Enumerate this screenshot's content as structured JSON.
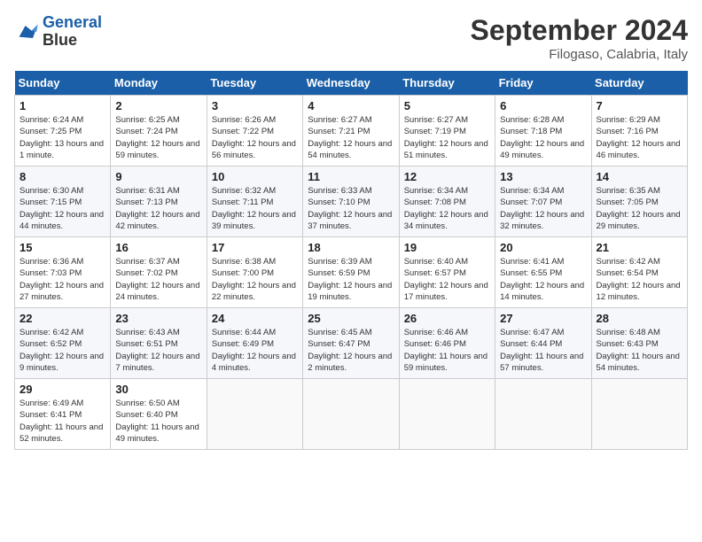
{
  "header": {
    "logo_general": "General",
    "logo_blue": "Blue",
    "month_title": "September 2024",
    "location": "Filogaso, Calabria, Italy"
  },
  "weekdays": [
    "Sunday",
    "Monday",
    "Tuesday",
    "Wednesday",
    "Thursday",
    "Friday",
    "Saturday"
  ],
  "weeks": [
    [
      {
        "day": "1",
        "sunrise": "Sunrise: 6:24 AM",
        "sunset": "Sunset: 7:25 PM",
        "daylight": "Daylight: 13 hours and 1 minute."
      },
      {
        "day": "2",
        "sunrise": "Sunrise: 6:25 AM",
        "sunset": "Sunset: 7:24 PM",
        "daylight": "Daylight: 12 hours and 59 minutes."
      },
      {
        "day": "3",
        "sunrise": "Sunrise: 6:26 AM",
        "sunset": "Sunset: 7:22 PM",
        "daylight": "Daylight: 12 hours and 56 minutes."
      },
      {
        "day": "4",
        "sunrise": "Sunrise: 6:27 AM",
        "sunset": "Sunset: 7:21 PM",
        "daylight": "Daylight: 12 hours and 54 minutes."
      },
      {
        "day": "5",
        "sunrise": "Sunrise: 6:27 AM",
        "sunset": "Sunset: 7:19 PM",
        "daylight": "Daylight: 12 hours and 51 minutes."
      },
      {
        "day": "6",
        "sunrise": "Sunrise: 6:28 AM",
        "sunset": "Sunset: 7:18 PM",
        "daylight": "Daylight: 12 hours and 49 minutes."
      },
      {
        "day": "7",
        "sunrise": "Sunrise: 6:29 AM",
        "sunset": "Sunset: 7:16 PM",
        "daylight": "Daylight: 12 hours and 46 minutes."
      }
    ],
    [
      {
        "day": "8",
        "sunrise": "Sunrise: 6:30 AM",
        "sunset": "Sunset: 7:15 PM",
        "daylight": "Daylight: 12 hours and 44 minutes."
      },
      {
        "day": "9",
        "sunrise": "Sunrise: 6:31 AM",
        "sunset": "Sunset: 7:13 PM",
        "daylight": "Daylight: 12 hours and 42 minutes."
      },
      {
        "day": "10",
        "sunrise": "Sunrise: 6:32 AM",
        "sunset": "Sunset: 7:11 PM",
        "daylight": "Daylight: 12 hours and 39 minutes."
      },
      {
        "day": "11",
        "sunrise": "Sunrise: 6:33 AM",
        "sunset": "Sunset: 7:10 PM",
        "daylight": "Daylight: 12 hours and 37 minutes."
      },
      {
        "day": "12",
        "sunrise": "Sunrise: 6:34 AM",
        "sunset": "Sunset: 7:08 PM",
        "daylight": "Daylight: 12 hours and 34 minutes."
      },
      {
        "day": "13",
        "sunrise": "Sunrise: 6:34 AM",
        "sunset": "Sunset: 7:07 PM",
        "daylight": "Daylight: 12 hours and 32 minutes."
      },
      {
        "day": "14",
        "sunrise": "Sunrise: 6:35 AM",
        "sunset": "Sunset: 7:05 PM",
        "daylight": "Daylight: 12 hours and 29 minutes."
      }
    ],
    [
      {
        "day": "15",
        "sunrise": "Sunrise: 6:36 AM",
        "sunset": "Sunset: 7:03 PM",
        "daylight": "Daylight: 12 hours and 27 minutes."
      },
      {
        "day": "16",
        "sunrise": "Sunrise: 6:37 AM",
        "sunset": "Sunset: 7:02 PM",
        "daylight": "Daylight: 12 hours and 24 minutes."
      },
      {
        "day": "17",
        "sunrise": "Sunrise: 6:38 AM",
        "sunset": "Sunset: 7:00 PM",
        "daylight": "Daylight: 12 hours and 22 minutes."
      },
      {
        "day": "18",
        "sunrise": "Sunrise: 6:39 AM",
        "sunset": "Sunset: 6:59 PM",
        "daylight": "Daylight: 12 hours and 19 minutes."
      },
      {
        "day": "19",
        "sunrise": "Sunrise: 6:40 AM",
        "sunset": "Sunset: 6:57 PM",
        "daylight": "Daylight: 12 hours and 17 minutes."
      },
      {
        "day": "20",
        "sunrise": "Sunrise: 6:41 AM",
        "sunset": "Sunset: 6:55 PM",
        "daylight": "Daylight: 12 hours and 14 minutes."
      },
      {
        "day": "21",
        "sunrise": "Sunrise: 6:42 AM",
        "sunset": "Sunset: 6:54 PM",
        "daylight": "Daylight: 12 hours and 12 minutes."
      }
    ],
    [
      {
        "day": "22",
        "sunrise": "Sunrise: 6:42 AM",
        "sunset": "Sunset: 6:52 PM",
        "daylight": "Daylight: 12 hours and 9 minutes."
      },
      {
        "day": "23",
        "sunrise": "Sunrise: 6:43 AM",
        "sunset": "Sunset: 6:51 PM",
        "daylight": "Daylight: 12 hours and 7 minutes."
      },
      {
        "day": "24",
        "sunrise": "Sunrise: 6:44 AM",
        "sunset": "Sunset: 6:49 PM",
        "daylight": "Daylight: 12 hours and 4 minutes."
      },
      {
        "day": "25",
        "sunrise": "Sunrise: 6:45 AM",
        "sunset": "Sunset: 6:47 PM",
        "daylight": "Daylight: 12 hours and 2 minutes."
      },
      {
        "day": "26",
        "sunrise": "Sunrise: 6:46 AM",
        "sunset": "Sunset: 6:46 PM",
        "daylight": "Daylight: 11 hours and 59 minutes."
      },
      {
        "day": "27",
        "sunrise": "Sunrise: 6:47 AM",
        "sunset": "Sunset: 6:44 PM",
        "daylight": "Daylight: 11 hours and 57 minutes."
      },
      {
        "day": "28",
        "sunrise": "Sunrise: 6:48 AM",
        "sunset": "Sunset: 6:43 PM",
        "daylight": "Daylight: 11 hours and 54 minutes."
      }
    ],
    [
      {
        "day": "29",
        "sunrise": "Sunrise: 6:49 AM",
        "sunset": "Sunset: 6:41 PM",
        "daylight": "Daylight: 11 hours and 52 minutes."
      },
      {
        "day": "30",
        "sunrise": "Sunrise: 6:50 AM",
        "sunset": "Sunset: 6:40 PM",
        "daylight": "Daylight: 11 hours and 49 minutes."
      },
      null,
      null,
      null,
      null,
      null
    ]
  ]
}
